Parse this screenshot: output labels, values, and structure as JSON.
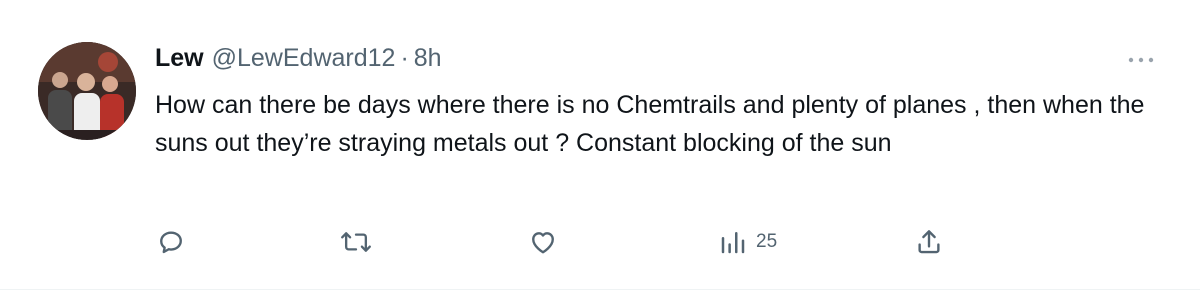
{
  "tweet": {
    "author_name": "Lew",
    "handle": "@LewEdward12",
    "separator": "·",
    "timestamp": "8h",
    "text": "How can there be days where there is no Chemtrails and plenty of planes , then when the suns out they’re straying metals out ? Constant blocking of the sun"
  },
  "actions": {
    "reply_icon": "reply-icon",
    "retweet_icon": "retweet-icon",
    "like_icon": "heart-icon",
    "views_icon": "bar-chart-icon",
    "views_count": "25",
    "share_icon": "share-icon"
  },
  "colors": {
    "text": "#0f1419",
    "secondary": "#536471",
    "background": "#ffffff"
  }
}
